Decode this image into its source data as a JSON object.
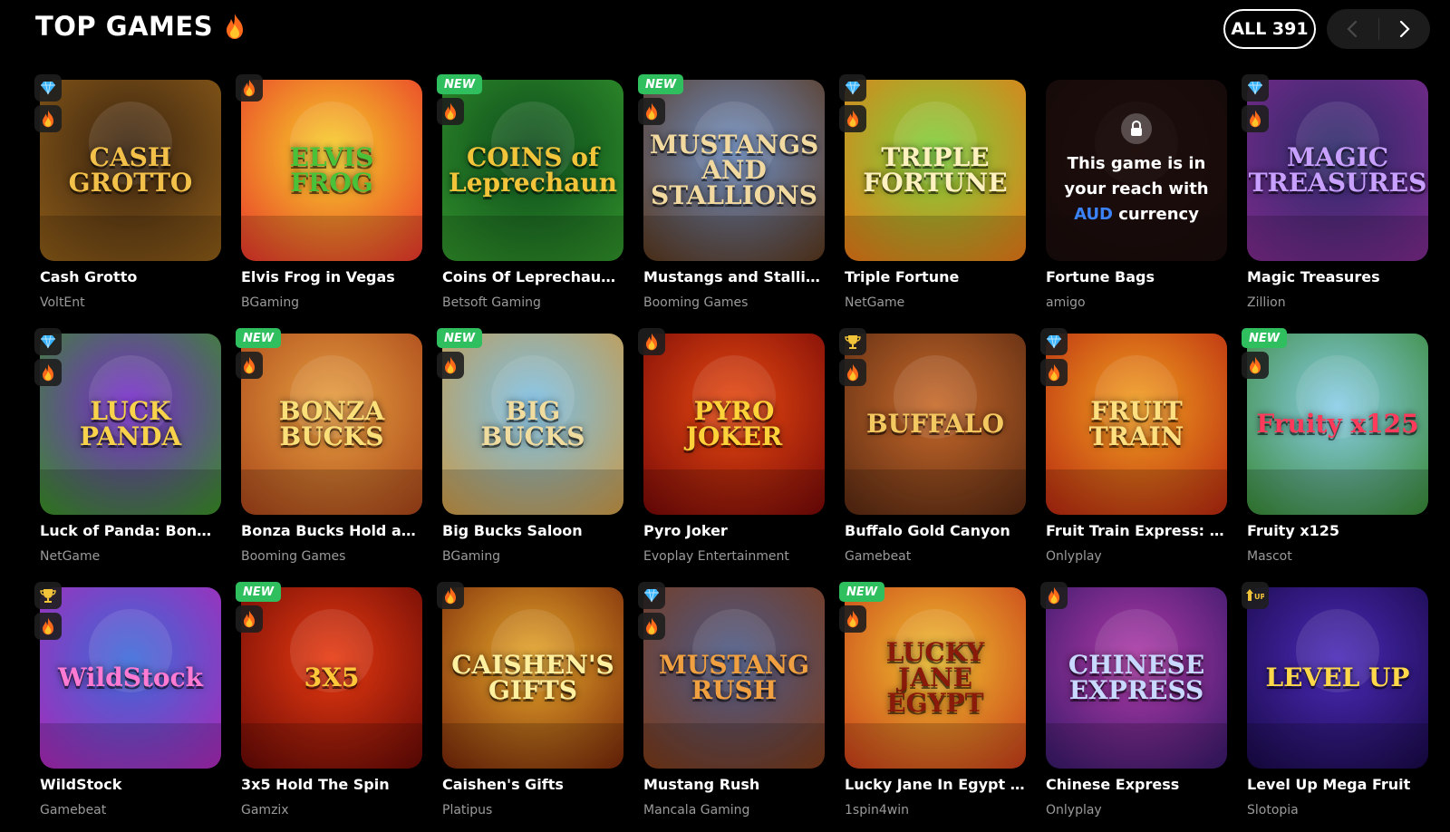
{
  "header": {
    "title": "TOP GAMES",
    "all_button": "ALL 391"
  },
  "locked_message": {
    "line1": "This game is in",
    "line2": "your reach with",
    "currency": "AUD",
    "line3_rest": " currency"
  },
  "colors": {
    "background": "#000000",
    "new_badge": "#2fbf5f",
    "currency_highlight": "#3b82f6",
    "provider_text": "#9a9a9a"
  },
  "games": [
    {
      "name": "Cash Grotto",
      "provider": "VoltEnt",
      "badges": [
        "diamond-icon",
        "fire-icon"
      ],
      "art": "CASH GROTTO",
      "c1": "#3a2410",
      "c2": "#8a5a18",
      "fg": "#f3c04a"
    },
    {
      "name": "Elvis Frog in Vegas",
      "provider": "BGaming",
      "badges": [
        "fire-icon"
      ],
      "art": "ELVIS FROG",
      "c1": "#f7d22a",
      "c2": "#e83a2a",
      "fg": "#49c23a"
    },
    {
      "name": "Coins Of Leprechaun ...",
      "provider": "Betsoft Gaming",
      "badges": [
        "NEW",
        "fire-icon"
      ],
      "art": "COINS of Leprechaun",
      "c1": "#0d4a1c",
      "c2": "#2f8f2a",
      "fg": "#f2c43a"
    },
    {
      "name": "Mustangs and Stallions",
      "provider": "Booming Games",
      "badges": [
        "NEW",
        "fire-icon"
      ],
      "art": "MUSTANGS AND STALLIONS",
      "c1": "#6e8fc4",
      "c2": "#5a3a22",
      "fg": "#f1d9a0"
    },
    {
      "name": "Triple Fortune",
      "provider": "NetGame",
      "badges": [
        "diamond-icon",
        "fire-icon"
      ],
      "art": "TRIPLE FORTUNE",
      "c1": "#7bd23a",
      "c2": "#e47a18",
      "fg": "#fff2c0"
    },
    {
      "name": "Fortune Bags",
      "provider": "amigo",
      "badges": [],
      "art": "",
      "c1": "#3a1a10",
      "c2": "#1a0a08",
      "fg": "#ffffff",
      "locked": true
    },
    {
      "name": "Magic Treasures",
      "provider": "Zillion",
      "badges": [
        "diamond-icon",
        "fire-icon"
      ],
      "art": "MAGIC TREASURES",
      "c1": "#2a2a6a",
      "c2": "#7a2a8a",
      "fg": "#c8a0ff"
    },
    {
      "name": "Luck of Panda: Bonus...",
      "provider": "NetGame",
      "badges": [
        "diamond-icon",
        "fire-icon"
      ],
      "art": "LUCK PANDA",
      "c1": "#7a2ad2",
      "c2": "#3a8a2a",
      "fg": "#f7d24a"
    },
    {
      "name": "Bonza Bucks Hold an...",
      "provider": "Booming Games",
      "badges": [
        "NEW",
        "fire-icon"
      ],
      "art": "BONZA BUCKS",
      "c1": "#e8a040",
      "c2": "#a8461a",
      "fg": "#fbe07a"
    },
    {
      "name": "Big Bucks Saloon",
      "provider": "BGaming",
      "badges": [
        "NEW",
        "fire-icon"
      ],
      "art": "BIG BUCKS",
      "c1": "#7ac0e8",
      "c2": "#c89a4a",
      "fg": "#f1dca0"
    },
    {
      "name": "Pyro Joker",
      "provider": "Evoplay Entertainment",
      "badges": [
        "fire-icon"
      ],
      "art": "PYRO JOKER",
      "c1": "#e84a10",
      "c2": "#7a0a08",
      "fg": "#ffd23a"
    },
    {
      "name": "Buffalo Gold Canyon",
      "provider": "Gamebeat",
      "badges": [
        "trophy-icon",
        "fire-icon"
      ],
      "art": "BUFFALO",
      "c1": "#c86a2a",
      "c2": "#5a2a12",
      "fg": "#f4c860"
    },
    {
      "name": "Fruit Train Express: H...",
      "provider": "Onlyplay",
      "badges": [
        "diamond-icon",
        "fire-icon"
      ],
      "art": "FRUIT TRAIN",
      "c1": "#f2a020",
      "c2": "#b82a10",
      "fg": "#ffe080"
    },
    {
      "name": "Fruity x125",
      "provider": "Mascot",
      "badges": [
        "NEW",
        "fire-icon"
      ],
      "art": "Fruity x125",
      "c1": "#8acde8",
      "c2": "#3a8a3a",
      "fg": "#ff3a5a"
    },
    {
      "name": "WildStock",
      "provider": "Gamebeat",
      "badges": [
        "trophy-icon",
        "fire-icon"
      ],
      "art": "WildStock",
      "c1": "#3a6ad8",
      "c2": "#a82ab8",
      "fg": "#ff7ad2"
    },
    {
      "name": "3x5 Hold The Spin",
      "provider": "Gamzix",
      "badges": [
        "NEW",
        "fire-icon"
      ],
      "art": "3X5",
      "c1": "#e83a10",
      "c2": "#6a0a06",
      "fg": "#ffc83a"
    },
    {
      "name": "Caishen's Gifts",
      "provider": "Platipus",
      "badges": [
        "fire-icon"
      ],
      "art": "CAISHEN'S GIFTS",
      "c1": "#e8a82a",
      "c2": "#7a2a0a",
      "fg": "#fff0a0"
    },
    {
      "name": "Mustang Rush",
      "provider": "Mancala Gaming",
      "badges": [
        "diamond-icon",
        "fire-icon"
      ],
      "art": "MUSTANG RUSH",
      "c1": "#4a5a8a",
      "c2": "#7a3a1a",
      "fg": "#f0a040"
    },
    {
      "name": "Lucky Jane In Egypt F...",
      "provider": "1spin4win",
      "badges": [
        "NEW",
        "fire-icon"
      ],
      "art": "LUCKY JANE EGYPT",
      "c1": "#f0c030",
      "c2": "#c8401a",
      "fg": "#8a1a0a"
    },
    {
      "name": "Chinese Express",
      "provider": "Onlyplay",
      "badges": [
        "fire-icon"
      ],
      "art": "CHINESE EXPRESS",
      "c1": "#b03aa8",
      "c2": "#3a1a6a",
      "fg": "#c8d8ff"
    },
    {
      "name": "Level Up Mega Fruit",
      "provider": "Slotopia",
      "badges": [
        "levelup-icon"
      ],
      "art": "LEVEL UP",
      "c1": "#4a2ab8",
      "c2": "#1a0a4a",
      "fg": "#ffd84a"
    }
  ]
}
